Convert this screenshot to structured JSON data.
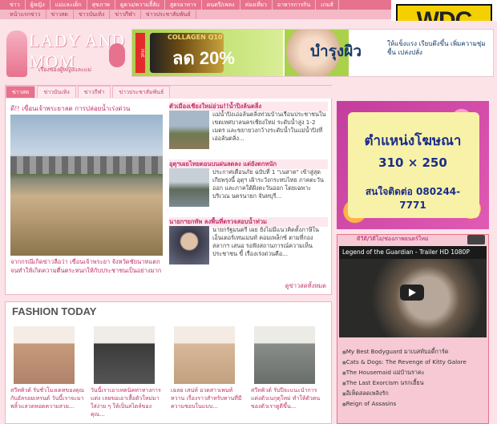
{
  "topnav": [
    "ข่าว",
    "ผู้หญิง",
    "แม่และเด็ก",
    "สุขภาพ",
    "ดูดวง/ความลี้ลับ",
    "สูตรอาหาร",
    "ดนตรี/เพลง",
    "ท่องเที่ยว",
    "อาหารการกิน",
    "เกมส์"
  ],
  "subnav": [
    "หน้าแรกข่าว",
    "ข่าวสด",
    "ข่าวบันเทิง",
    "ข่าวกีฬา",
    "ข่าวประชาสัมพันธ์"
  ],
  "badge": "WDC",
  "logo": {
    "title": "LADY AND MOM",
    "subtitle": "เรื่องของผู้หญิงและแม่"
  },
  "banner": {
    "hot": "Hot",
    "product": "COLLAGEN Q10",
    "sale": "ลด 20%",
    "headline": "บำรุงผิว",
    "copy": "ให้แข็งแรง เรียบตึงขึ้น เพิ่มความชุ่มชื้น เปล่งปลั่ง"
  },
  "tabs": [
    "ข่าวสด",
    "ข่าวบันเทิง",
    "ข่าวกีฬา",
    "ข่าวประชาสัมพันธ์"
  ],
  "lead": {
    "title": "ดี!! เขื่อนเจ้าพระยาลด การปล่อยน้ำเร่งด่วน",
    "caption": "จากกรณีเกิดข่าวลือว่า เขื่อนเจ้าพระยา จังหวัดชัยนาทแตก จนทำให้เกิดความตื่นตระหนกให้กับประชาชนเป็นอย่างมาก"
  },
  "news": [
    {
      "title": "ตัวเมืองเชียงใหม่อ่วม!!น้ำปิงล้นตลิ่ง",
      "text": "แม่น้ำปิงเอ่อล้นตลิ่งท่วมบ้านเรือนประชาชนในเขตเทศบาลนครเชียงใหม่ ระดับน้ำสูง 1-2 เมตร และขยายวงกว้างระดับน้ำในแม่น้ำปิงที่เอ่อล้นตลิ่ง..."
    },
    {
      "title": "อุตุฯเผยไทยตอนบนฝนลดลง แต่ยังตกหนัก",
      "text": "ประกาศเตือนภัย ฉบับที่ 1 \"เนสาต\" เข้าสู่สุดเกียพรุงนี้ อุตุฯ เฝ้าระวังกระทบไทย ภาคตะวันออก และภาคใต้ฝั่งตะวันออก โดยเฉพาะบริเวณ นครนายก จันทบุรี..."
    },
    {
      "title": "นายกฯยกทัพ ลงพื้นที่ตรวจสอบน้ำท่วม",
      "text": "นายกรัฐมนตรี เผย ยังไม่มีแนวคิดตั้งภาษีใน เอ็นเตอร์เทนเมนท์ คอมเพล็กซ์ ตามที่กองสลากฯ เสนอ รอฟังสถานการณ์ความเห็นประชาชน ขี้ เรื่องเร่งด่วนคือ..."
    }
  ],
  "more_link": "ดูข่าวสดทั้งหมด",
  "ad": {
    "line1": "ตำแหน่งโฆษณา",
    "line2": "310 × 250",
    "line3": "สนใจติดต่อ 080244-7771"
  },
  "video": {
    "tag": "ดีวีดี/วิดีโอ/ช่องภาพยนตร์ใหม่",
    "player_title": "Legend of the Guardian - Trailer HD 1080P",
    "list": [
      "My Best Bodyguard มาเบสท์บอดี้การ์ด",
      "Cats & Dogs: The Revenge of Kitty Galore",
      "The Housemaid แม่บ้านราคะ",
      "The Last Exorcism นรกเฮี้ยน",
      "อีเห็ดสลดเพลิงรัก",
      "Reign of Assasins"
    ]
  },
  "fashion": {
    "title": "FASHION TODAY",
    "items": [
      {
        "caption": "สวีทคิวต์ รับชั่วโมงเดทของคุณกับอัลรอยเทรนด์ วันนี้เราจะมาพลิ้วแลวดหอดความสวย...",
        "color": "#c79a7a"
      },
      {
        "caption": "วันนี้เราเอาเทคนิคท่าทางการแต่ง เลยขอเอาเสื้อตัวใหม่มาใส่ง่าย ๆ ให้เป็นสไตล์ของคุณ...",
        "color": "#3a3a3a"
      },
      {
        "caption": "เฉลย เสน่ห์ อวดสาวเพนท์หวาน เรื่องราวสำหรับทานที่มีความชอบในแบบ...",
        "color": "#d8b99a"
      },
      {
        "caption": "สวีทคิวต์ รับปีจะแนะนำการแต่งตัวเนกุดุใหม่ ทำให้ตัวตนของตัวเราดูดีขึ้น...",
        "color": "#8a8e8a"
      }
    ]
  }
}
